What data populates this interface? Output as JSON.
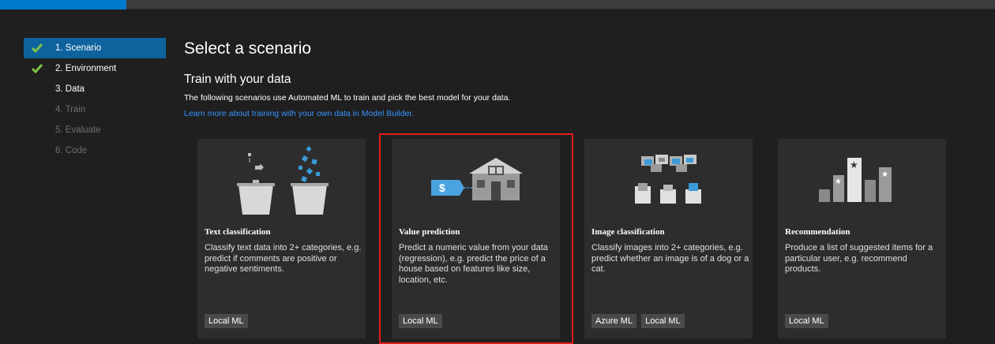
{
  "steps": [
    {
      "label": "1. Scenario",
      "state": "active",
      "checked": true
    },
    {
      "label": "2. Environment",
      "state": "done",
      "checked": true
    },
    {
      "label": "3. Data",
      "state": "current",
      "checked": false
    },
    {
      "label": "4. Train",
      "state": "disabled",
      "checked": false
    },
    {
      "label": "5. Evaluate",
      "state": "disabled",
      "checked": false
    },
    {
      "label": "6. Code",
      "state": "disabled",
      "checked": false
    }
  ],
  "main": {
    "title": "Select a scenario",
    "subtitle": "Train with your data",
    "description": "The following scenarios use Automated ML to train and pick the best model for your data.",
    "learn_link": "Learn more about training with your own data in Model Builder."
  },
  "cards": [
    {
      "title": "Text classification",
      "description": "Classify text data into 2+ categories, e.g. predict if comments are positive or negative sentiments.",
      "tags": [
        "Local ML"
      ],
      "icon": "buckets-icon"
    },
    {
      "title": "Value prediction",
      "description": "Predict a numeric value from your data (regression), e.g. predict the price of a house based on features like size, location, etc.",
      "tags": [
        "Local ML"
      ],
      "icon": "house-price-icon",
      "selected": true
    },
    {
      "title": "Image classification",
      "description": "Classify images into 2+ categories, e.g. predict whether an image is of a dog or a cat.",
      "tags": [
        "Azure ML",
        "Local ML"
      ],
      "icon": "image-sort-icon"
    },
    {
      "title": "Recommendation",
      "description": "Produce a list of suggested items for a particular user, e.g. recommend products.",
      "tags": [
        "Local ML"
      ],
      "icon": "bar-stars-icon"
    }
  ],
  "colors": {
    "background": "#1f1f1f",
    "card": "#2d2d2d",
    "accent": "#0e639c",
    "link": "#3794ff",
    "check": "#7ec24a",
    "selection": "#e11b1b"
  }
}
